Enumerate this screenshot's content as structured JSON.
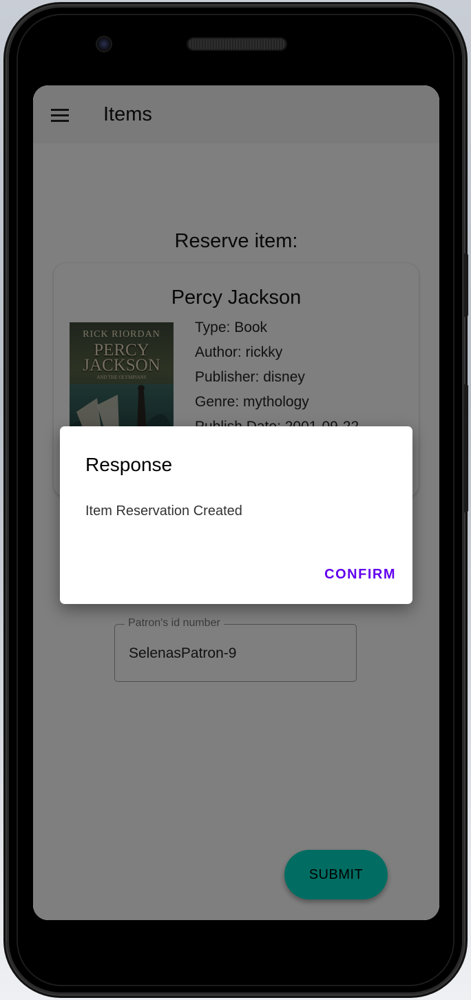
{
  "app_bar": {
    "title": "Items",
    "menu_icon": "hamburger-menu-icon"
  },
  "reserve": {
    "heading": "Reserve item:",
    "item": {
      "title": "Percy Jackson",
      "cover": {
        "author_text": "RICK RIORDAN",
        "title_line1": "PERCY",
        "title_line2": "JACKSON",
        "subtitle": "AND THE OLYMPIANS"
      },
      "details": [
        "Type: Book",
        "Author: rickky",
        "Publisher: disney",
        "Genre: mythology",
        "Publish Date: 2001-09-22"
      ]
    },
    "patron_field": {
      "label": "Patron's id number",
      "value": "SelenasPatron-9"
    },
    "submit_label": "SUBMIT"
  },
  "dialog": {
    "title": "Response",
    "message": "Item Reservation Created",
    "confirm_label": "CONFIRM"
  },
  "colors": {
    "accent": "#6200ee",
    "fab": "#03dac5",
    "app_bar": "#f5f5f5",
    "scrim": "rgba(0,0,0,0.5)"
  }
}
